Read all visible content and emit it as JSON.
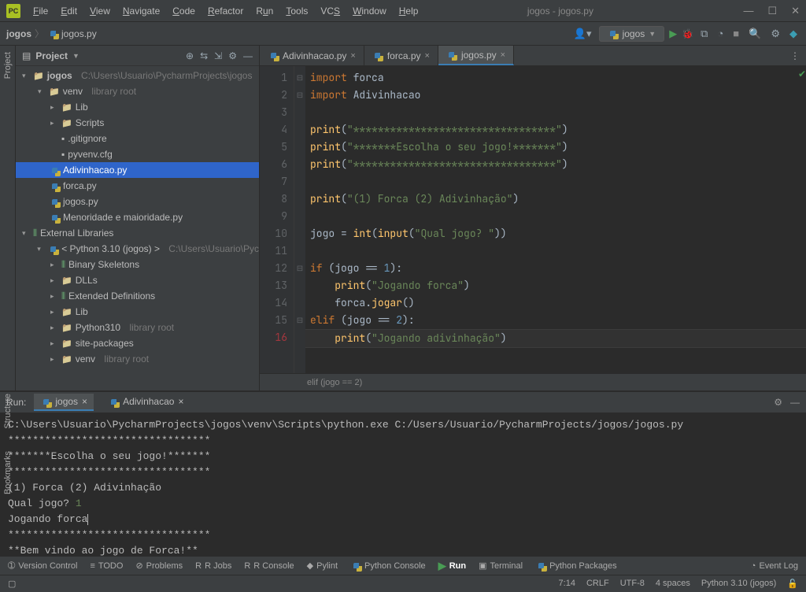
{
  "window": {
    "title": "jogos - jogos.py"
  },
  "menu": [
    "File",
    "Edit",
    "View",
    "Navigate",
    "Code",
    "Refactor",
    "Run",
    "Tools",
    "VCS",
    "Window",
    "Help"
  ],
  "breadcrumb": {
    "root": "jogos",
    "file": "jogos.py"
  },
  "run_config": {
    "name": "jogos"
  },
  "project_panel": {
    "title": "Project",
    "root": {
      "name": "jogos",
      "path": "C:\\Users\\Usuario\\PycharmProjects\\jogos"
    },
    "venv": {
      "name": "venv",
      "hint": "library root"
    },
    "lib": "Lib",
    "scripts": "Scripts",
    "gitignore": ".gitignore",
    "pyvenv": "pyvenv.cfg",
    "adiv": "Adivinhacao.py",
    "forca": "forca.py",
    "jogos": "jogos.py",
    "menor": "Menoridade e maioridade.py",
    "extlib": "External Libraries",
    "pyenv": {
      "name": "< Python 3.10 (jogos) >",
      "path": "C:\\Users\\Usuario\\Pyc"
    },
    "binskel": "Binary Skeletons",
    "dlls": "DLLs",
    "extdef": "Extended Definitions",
    "lib2": "Lib",
    "py310": {
      "name": "Python310",
      "hint": "library root"
    },
    "sitepkg": "site-packages",
    "venv2": {
      "name": "venv",
      "hint": "library root"
    }
  },
  "editor_tabs": [
    {
      "label": "Adivinhacao.py",
      "active": false
    },
    {
      "label": "forca.py",
      "active": false
    },
    {
      "label": "jogos.py",
      "active": true
    }
  ],
  "code_lines": [
    "import forca",
    "import Adivinhacao",
    "",
    "print(\"*********************************\")",
    "print(\"*******Escolha o seu jogo!*******\")",
    "print(\"*********************************\")",
    "",
    "print(\"(1) Forca (2) Adivinhação\")",
    "",
    "jogo = int(input(\"Qual jogo? \"))",
    "",
    "if (jogo == 1):",
    "    print(\"Jogando forca\")",
    "    forca.jogar()",
    "elif (jogo == 2):",
    "    print(\"Jogando adivinhação\")"
  ],
  "breadcrumb_code": "elif (jogo == 2)",
  "run": {
    "title": "Run:",
    "tabs": [
      {
        "label": "jogos",
        "active": true
      },
      {
        "label": "Adivinhacao",
        "active": false
      }
    ],
    "output": "C:\\Users\\Usuario\\PycharmProjects\\jogos\\venv\\Scripts\\python.exe C:/Users/Usuario/PycharmProjects/jogos/jogos.py\n*********************************\n*******Escolha o seu jogo!*******\n*********************************\n(1) Forca (2) Adivinhação\nQual jogo? ",
    "input": "1",
    "output2": "Jogando forca",
    "output3": "*********************************\n**Bem vindo ao jogo de Forca!**"
  },
  "bottom_tabs": [
    "Version Control",
    "TODO",
    "Problems",
    "R Jobs",
    "R Console",
    "Pylint",
    "Python Console",
    "Run",
    "Terminal",
    "Python Packages",
    "Event Log"
  ],
  "status": {
    "pos": "7:14",
    "eol": "CRLF",
    "enc": "UTF-8",
    "indent": "4 spaces",
    "interp": "Python 3.10 (jogos)"
  }
}
